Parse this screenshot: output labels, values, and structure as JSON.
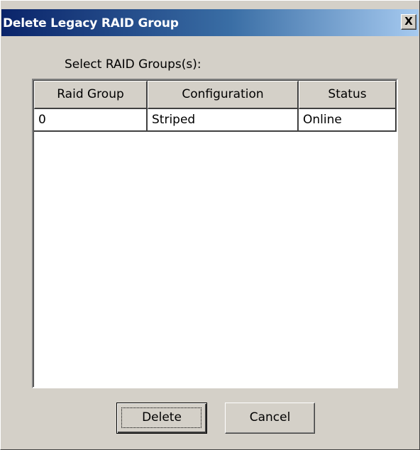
{
  "window": {
    "title": "Delete Legacy RAID Group",
    "close_glyph": "X"
  },
  "prompt_label": "Select RAID Groups(s):",
  "table": {
    "columns": [
      "Raid Group",
      "Configuration",
      "Status"
    ],
    "rows": [
      [
        "0",
        "Striped",
        "Online"
      ]
    ]
  },
  "buttons": {
    "delete_label": "Delete",
    "cancel_label": "Cancel"
  },
  "colors": {
    "title_gradient_start": "#0a246a",
    "title_gradient_end": "#a6caf0",
    "dialog_face": "#d4d0c8"
  }
}
